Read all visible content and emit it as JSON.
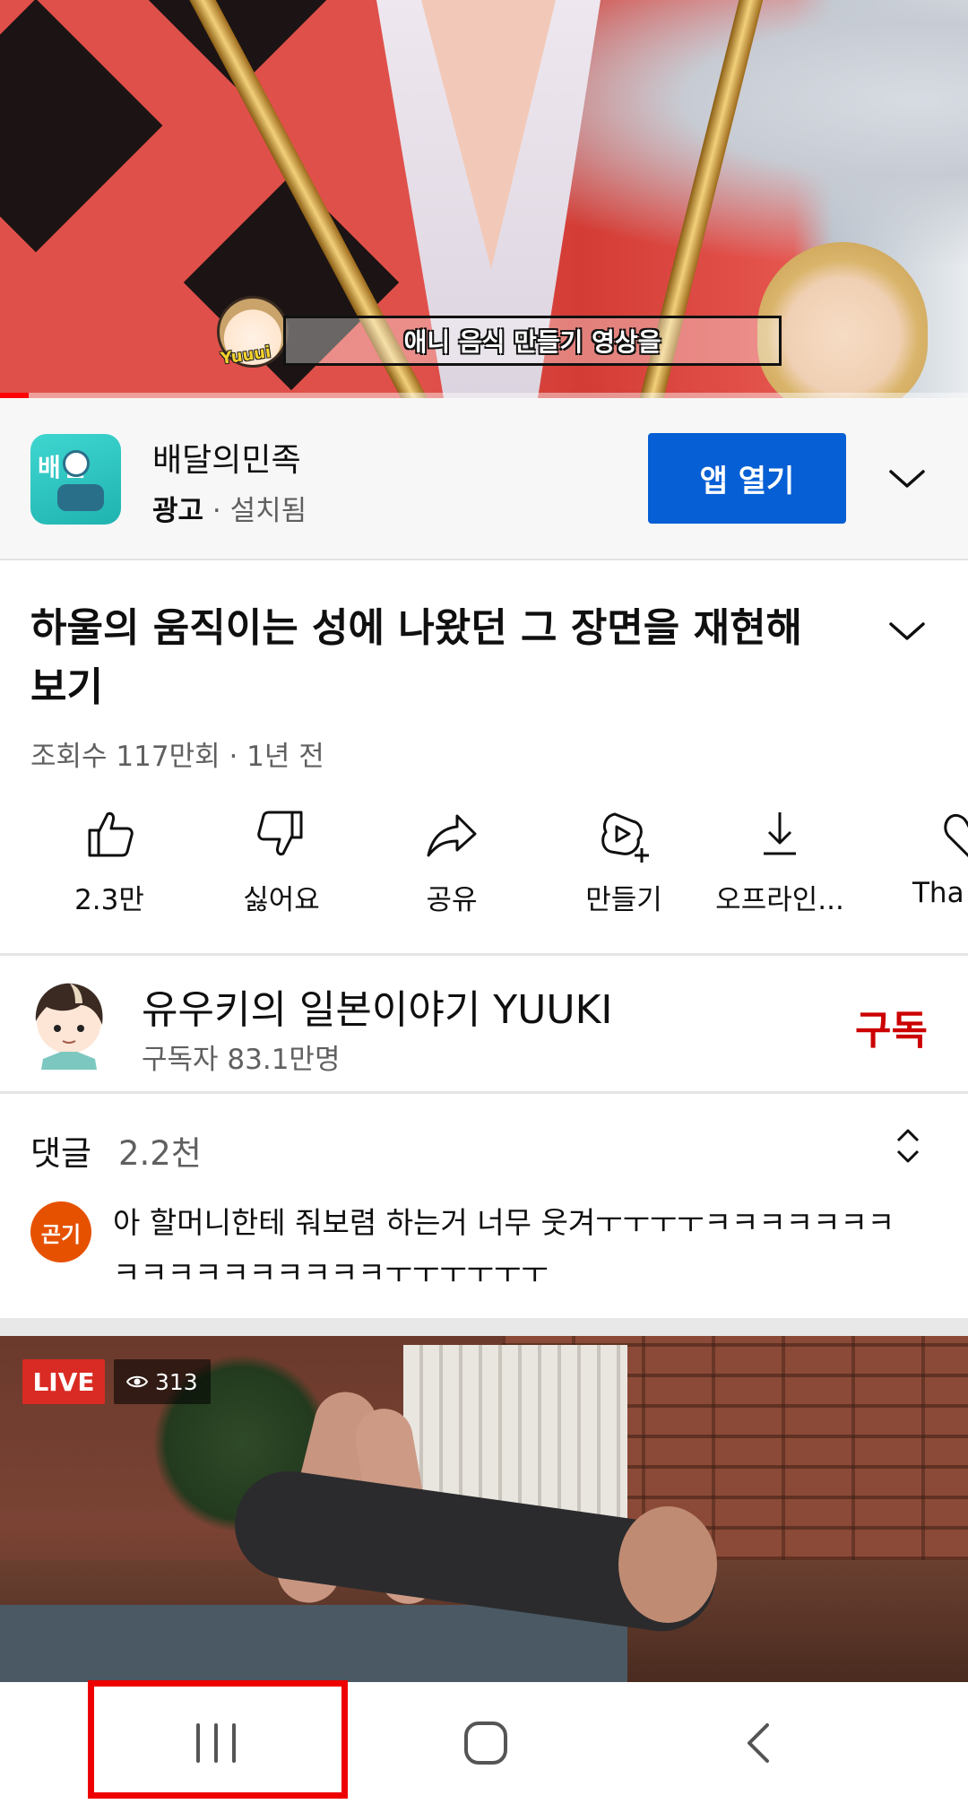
{
  "player": {
    "subtitle": "애니 음식 만들기 영상을",
    "sticker_label": "Yuuui",
    "progress_percent": 3
  },
  "ad": {
    "app_name": "배달의민족",
    "icon_text": "배민",
    "badge": "광고",
    "separator": " · ",
    "status": "설치됨",
    "open_button": "앱 열기"
  },
  "video": {
    "title": "하울의 움직이는 성에 나왔던 그 장면을 재현해보기",
    "meta": "조회수 117만회 · 1년 전"
  },
  "actions": [
    {
      "label": "2.3만",
      "icon": "thumbs-up-icon"
    },
    {
      "label": "싫어요",
      "icon": "thumbs-down-icon"
    },
    {
      "label": "공유",
      "icon": "share-icon"
    },
    {
      "label": "만들기",
      "icon": "remix-icon"
    },
    {
      "label": "오프라인...",
      "icon": "download-icon"
    },
    {
      "label": "Tha",
      "icon": "thanks-icon"
    }
  ],
  "channel": {
    "name": "유우키의 일본이야기 YUUKI",
    "subscribers": "구독자 83.1만명",
    "subscribe_label": "구독"
  },
  "comments": {
    "label": "댓글",
    "count": "2.2천",
    "top_comment": {
      "avatar_text": "곤기",
      "text": "아 할머니한테 줘보렴 하는거 너무 웃겨ㅜㅜㅜㅜㅋㅋㅋㅋㅋㅋㅋㅋㅋㅋㅋㅋㅋㅋㅋㅋㅋㅜㅜㅜㅜㅜㅜ"
    }
  },
  "next_video": {
    "live_label": "LIVE",
    "viewers": "313"
  },
  "colors": {
    "accent_blue": "#065fd4",
    "subscribe_red": "#cc0000",
    "live_red": "#d92b23",
    "highlight_red": "#ee0000",
    "progress_red": "#ff0000"
  },
  "navbar": {
    "icons": [
      "recents-icon",
      "home-icon",
      "back-icon"
    ]
  }
}
